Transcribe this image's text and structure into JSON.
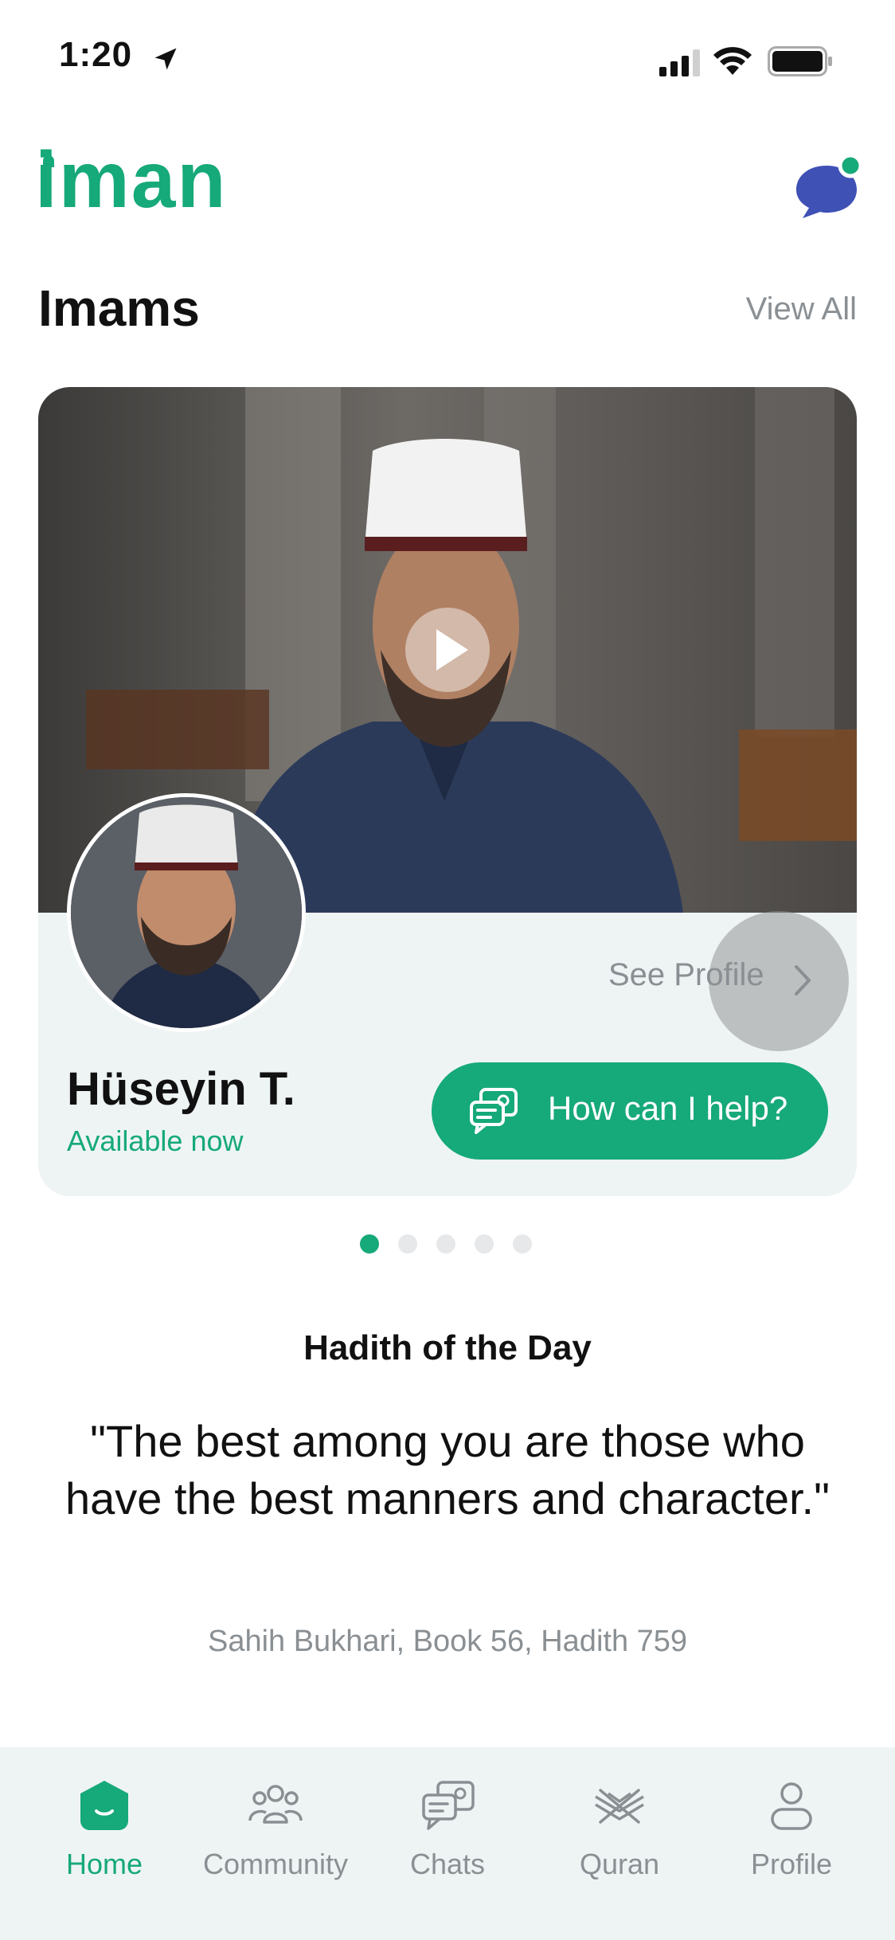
{
  "status_bar": {
    "time": "1:20",
    "icons": [
      "location-arrow-icon",
      "cellular-signal-icon",
      "wifi-icon",
      "battery-icon"
    ]
  },
  "header": {
    "logo_text": "iman",
    "chat_icon": "chat-bubble-icon"
  },
  "imams": {
    "title": "Imams",
    "view_all": "View All",
    "card": {
      "name": "Hüseyin T.",
      "availability": "Available now",
      "see_profile": "See Profile",
      "help_button": "How can I help?"
    },
    "pager": {
      "count": 5,
      "active": 0
    }
  },
  "hadith": {
    "heading": "Hadith of the Day",
    "quote": "\"The best among you are those who have the best manners and character.\"",
    "source": "Sahih Bukhari, Book 56, Hadith 759"
  },
  "tabbar": {
    "items": [
      {
        "label": "Home",
        "icon": "home-icon",
        "active": true
      },
      {
        "label": "Community",
        "icon": "community-icon",
        "active": false
      },
      {
        "label": "Chats",
        "icon": "chats-icon",
        "active": false
      },
      {
        "label": "Quran",
        "icon": "quran-icon",
        "active": false
      },
      {
        "label": "Profile",
        "icon": "profile-icon",
        "active": false
      }
    ]
  },
  "colors": {
    "brand": "#16a979",
    "chat_icon": "#3f51b5",
    "muted_text": "#8a8f93",
    "card_bg": "#eef4f4"
  }
}
